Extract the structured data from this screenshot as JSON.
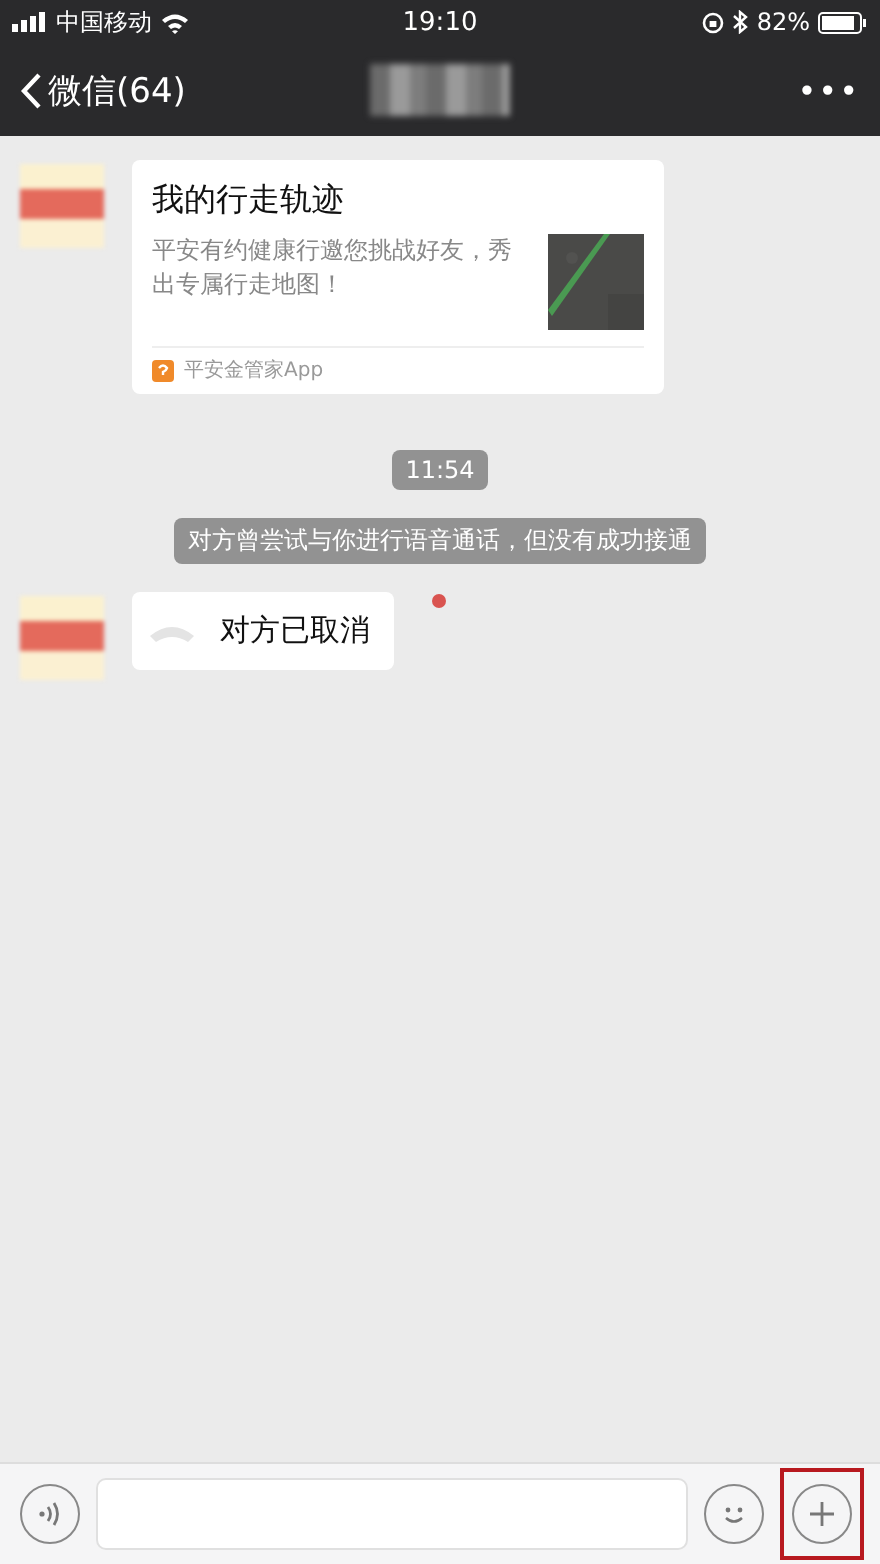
{
  "status_bar": {
    "carrier": "中国移动",
    "time": "19:10",
    "battery": "82%"
  },
  "nav": {
    "back_label": "微信(64)",
    "more": "•••"
  },
  "messages": [
    {
      "kind": "card",
      "title": "我的行走轨迹",
      "description": "平安有约健康行邀您挑战好友，秀出专属行走地图！",
      "source": "平安金管家App"
    },
    {
      "kind": "time",
      "text": "11:54"
    },
    {
      "kind": "system",
      "text": "对方曾尝试与你进行语音通话，但没有成功接通"
    },
    {
      "kind": "call",
      "text": "对方已取消",
      "unread": true
    }
  ],
  "input_bar": {
    "highlight_plus": true
  }
}
